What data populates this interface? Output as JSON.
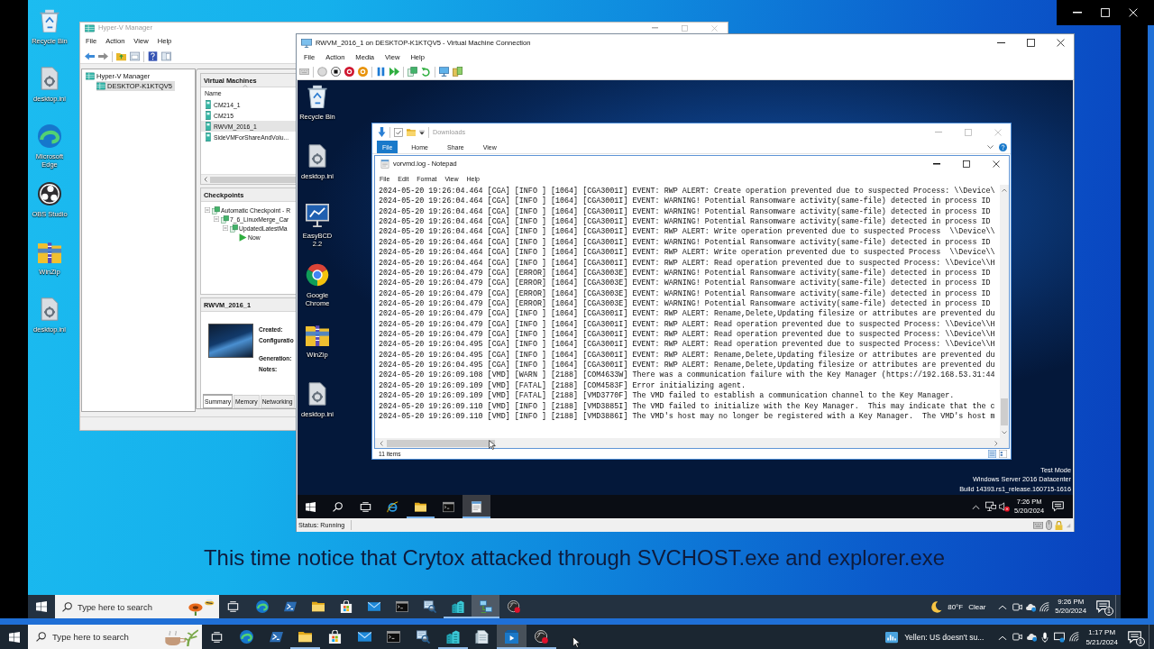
{
  "remote_desktop": {
    "icons": [
      {
        "kind": "recycle-bin",
        "label": "Recycle Bin"
      },
      {
        "kind": "file",
        "label": "desktop.ini"
      },
      {
        "kind": "edge",
        "label": "Microsoft Edge"
      },
      {
        "kind": "obs",
        "label": "OBS Studio"
      },
      {
        "kind": "winzip",
        "label": "WinZip"
      },
      {
        "kind": "file",
        "label": "desktop.ini"
      }
    ]
  },
  "hyperv_manager": {
    "title": "Hyper-V Manager",
    "menu": [
      "File",
      "Action",
      "View",
      "Help"
    ],
    "tree": [
      {
        "label": "Hyper-V Manager",
        "selected": false,
        "children": [
          {
            "label": "DESKTOP-K1KTQV5",
            "selected": true
          }
        ]
      }
    ],
    "virtual_machines": {
      "title": "Virtual Machines",
      "column": "Name",
      "rows": [
        {
          "name": "CM214_1",
          "selected": false
        },
        {
          "name": "CM215",
          "selected": false
        },
        {
          "name": "RWVM_2016_1",
          "selected": true
        },
        {
          "name": "SideVMForShareAndVolu...",
          "selected": false
        }
      ]
    },
    "checkpoints": {
      "title": "Checkpoints",
      "tree": [
        {
          "kind": "checkpoint",
          "label": "Automatic Checkpoint - R",
          "children": [
            {
              "kind": "checkpoint",
              "label": "7_6_LinuxMerge_Car",
              "children": [
                {
                  "kind": "checkpoint",
                  "label": "UpdatedLatestMa",
                  "children": [
                    {
                      "kind": "current",
                      "label": "Now"
                    }
                  ]
                }
              ]
            }
          ]
        }
      ]
    },
    "details": {
      "title": "RWVM_2016_1",
      "fields": [
        "Created:",
        "Configuratio",
        "Generation:",
        "Notes:"
      ],
      "tabs": [
        {
          "label": "Summary",
          "selected": true
        },
        {
          "label": "Memory",
          "selected": false
        },
        {
          "label": "Networking",
          "selected": false
        }
      ]
    }
  },
  "vm_connection": {
    "title": "RWVM_2016_1 on DESKTOP-K1KTQV5 - Virtual Machine Connection",
    "menu": [
      "File",
      "Action",
      "Media",
      "View",
      "Help"
    ],
    "guest": {
      "icons": [
        {
          "kind": "recycle-bin",
          "label": "Recycle Bin"
        },
        {
          "kind": "file",
          "label": "desktop.ini"
        },
        {
          "kind": "easybcd",
          "label": "EasyBCD 2.2"
        },
        {
          "kind": "chrome",
          "label": "Google Chrome"
        },
        {
          "kind": "winzip",
          "label": "WinZip"
        },
        {
          "kind": "file",
          "label": "desktop.ini"
        }
      ],
      "explorer": {
        "title": "Downloads",
        "tabs": [
          {
            "label": "File",
            "selected": true
          },
          {
            "label": "Home",
            "selected": false
          },
          {
            "label": "Share",
            "selected": false
          },
          {
            "label": "View",
            "selected": false
          }
        ],
        "status": "11 items"
      },
      "notepad": {
        "title": "vorvmd.log - Notepad",
        "menu": [
          "File",
          "Edit",
          "Format",
          "View",
          "Help"
        ],
        "lines": [
          "2024-05-20 19:26:04.464 [CGA] [INFO ] [1064] [CGA3001I] EVENT: RWP ALERT: Create operation prevented due to suspected Process: \\\\Device\\",
          "2024-05-20 19:26:04.464 [CGA] [INFO ] [1064] [CGA3001I] EVENT: WARNING! Potential Ransomware activity(same-file) detected in process ID",
          "2024-05-20 19:26:04.464 [CGA] [INFO ] [1064] [CGA3001I] EVENT: WARNING! Potential Ransomware activity(same-file) detected in process ID",
          "2024-05-20 19:26:04.464 [CGA] [INFO ] [1064] [CGA3001I] EVENT: WARNING! Potential Ransomware activity(same-file) detected in process ID",
          "2024-05-20 19:26:04.464 [CGA] [INFO ] [1064] [CGA3001I] EVENT: RWP ALERT: Write operation prevented due to suspected Process  \\\\Device\\\\",
          "2024-05-20 19:26:04.464 [CGA] [INFO ] [1064] [CGA3001I] EVENT: WARNING! Potential Ransomware activity(same-file) detected in process ID",
          "2024-05-20 19:26:04.464 [CGA] [INFO ] [1064] [CGA3001I] EVENT: RWP ALERT: Write operation prevented due to suspected Process  \\\\Device\\\\",
          "2024-05-20 19:26:04.464 [CGA] [INFO ] [1064] [CGA3001I] EVENT: RWP ALERT: Read operation prevented due to suspected Process: \\\\Device\\\\H",
          "2024-05-20 19:26:04.479 [CGA] [ERROR] [1064] [CGA3003E] EVENT: WARNING! Potential Ransomware activity(same-file) detected in process ID",
          "2024-05-20 19:26:04.479 [CGA] [ERROR] [1064] [CGA3003E] EVENT: WARNING! Potential Ransomware activity(same-file) detected in process ID",
          "2024-05-20 19:26:04.479 [CGA] [ERROR] [1064] [CGA3003E] EVENT: WARNING! Potential Ransomware activity(same-file) detected in process ID",
          "2024-05-20 19:26:04.479 [CGA] [ERROR] [1064] [CGA3003E] EVENT: WARNING! Potential Ransomware activity(same-file) detected in process ID",
          "2024-05-20 19:26:04.479 [CGA] [INFO ] [1064] [CGA3001I] EVENT: RWP ALERT: Rename,Delete,Updating filesize or attributes are prevented du",
          "2024-05-20 19:26:04.479 [CGA] [INFO ] [1064] [CGA3001I] EVENT: RWP ALERT: Read operation prevented due to suspected Process: \\\\Device\\\\H",
          "2024-05-20 19:26:04.479 [CGA] [INFO ] [1064] [CGA3001I] EVENT: RWP ALERT: Read operation prevented due to suspected Process: \\\\Device\\\\H",
          "2024-05-20 19:26:04.495 [CGA] [INFO ] [1064] [CGA3001I] EVENT: RWP ALERT: Read operation prevented due to suspected Process: \\\\Device\\\\H",
          "2024-05-20 19:26:04.495 [CGA] [INFO ] [1064] [CGA3001I] EVENT: RWP ALERT: Rename,Delete,Updating filesize or attributes are prevented du",
          "2024-05-20 19:26:04.495 [CGA] [INFO ] [1064] [CGA3001I] EVENT: RWP ALERT: Rename,Delete,Updating filesize or attributes are prevented du",
          "2024-05-20 19:26:09.108 [VMD] [WARN ] [2188] [COM4633W] There was a communication failure with the Key Manager (https://192.168.53.31:44",
          "2024-05-20 19:26:09.109 [VMD] [FATAL] [2188] [COM4583F] Error initializing agent.",
          "2024-05-20 19:26:09.109 [VMD] [FATAL] [2188] [VMD3770F] The VMD failed to establish a communication channel to the Key Manager.",
          "2024-05-20 19:26:09.110 [VMD] [INFO ] [2188] [VMD3885I] The VMD failed to initialize with the Key Manager.  This may indicate that the c",
          "2024-05-20 19:26:09.110 [VMD] [INFO ] [2188] [VMD3886I] The VMD's host may no longer be registered with a Key Manager.  The VMD's host m"
        ]
      },
      "watermark": [
        "Test Mode",
        "Windows Server 2016 Datacenter",
        "Build 14393.rs1_release.160715-1616"
      ],
      "taskbar": {
        "apps": [
          {
            "kind": "ie",
            "running": false,
            "selected": false
          },
          {
            "kind": "explorer",
            "running": true,
            "selected": false
          },
          {
            "kind": "cmd",
            "running": false,
            "selected": false
          },
          {
            "kind": "notepad",
            "running": true,
            "selected": true
          }
        ],
        "time": "7:26 PM",
        "date": "5/20/2024"
      }
    },
    "status": "Status: Running"
  },
  "caption": "This time notice that Crytox attacked through SVCHOST.exe and explorer.exe",
  "remote_taskbar": {
    "search": {
      "placeholder": "Type here to search"
    },
    "apps": [
      {
        "kind": "edge",
        "running": false,
        "selected": false
      },
      {
        "kind": "powershell",
        "running": false,
        "selected": false
      },
      {
        "kind": "explorer",
        "running": false,
        "selected": false
      },
      {
        "kind": "store",
        "running": false,
        "selected": false
      },
      {
        "kind": "mail",
        "running": false,
        "selected": false
      },
      {
        "kind": "cmd",
        "running": false,
        "selected": false
      },
      {
        "kind": "monitor-search",
        "running": false,
        "selected": false
      },
      {
        "kind": "buildings",
        "running": true,
        "selected": false
      },
      {
        "kind": "network",
        "running": true,
        "selected": true
      },
      {
        "kind": "record",
        "running": false,
        "selected": false
      }
    ],
    "weather": {
      "temperature": "80°F",
      "condition": "Clear"
    },
    "time": "9:26 PM",
    "date": "5/20/2024",
    "notifications": "1"
  },
  "host_taskbar": {
    "search": {
      "placeholder": "Type here to search"
    },
    "apps": [
      {
        "kind": "edge",
        "running": false,
        "selected": false
      },
      {
        "kind": "powershell",
        "running": false,
        "selected": false
      },
      {
        "kind": "explorer",
        "running": true,
        "selected": false
      },
      {
        "kind": "store",
        "running": false,
        "selected": false
      },
      {
        "kind": "mail",
        "running": false,
        "selected": false
      },
      {
        "kind": "cmd",
        "running": false,
        "selected": false
      },
      {
        "kind": "monitor-search",
        "running": false,
        "selected": false
      },
      {
        "kind": "buildings",
        "running": true,
        "selected": false
      },
      {
        "kind": "document",
        "running": false,
        "selected": false
      },
      {
        "kind": "video",
        "running": true,
        "selected": true
      },
      {
        "kind": "record",
        "running": true,
        "selected": false
      }
    ],
    "news": "Yellen: US doesn't su...",
    "time": "1:17 PM",
    "date": "5/21/2024",
    "notifications": "1"
  }
}
